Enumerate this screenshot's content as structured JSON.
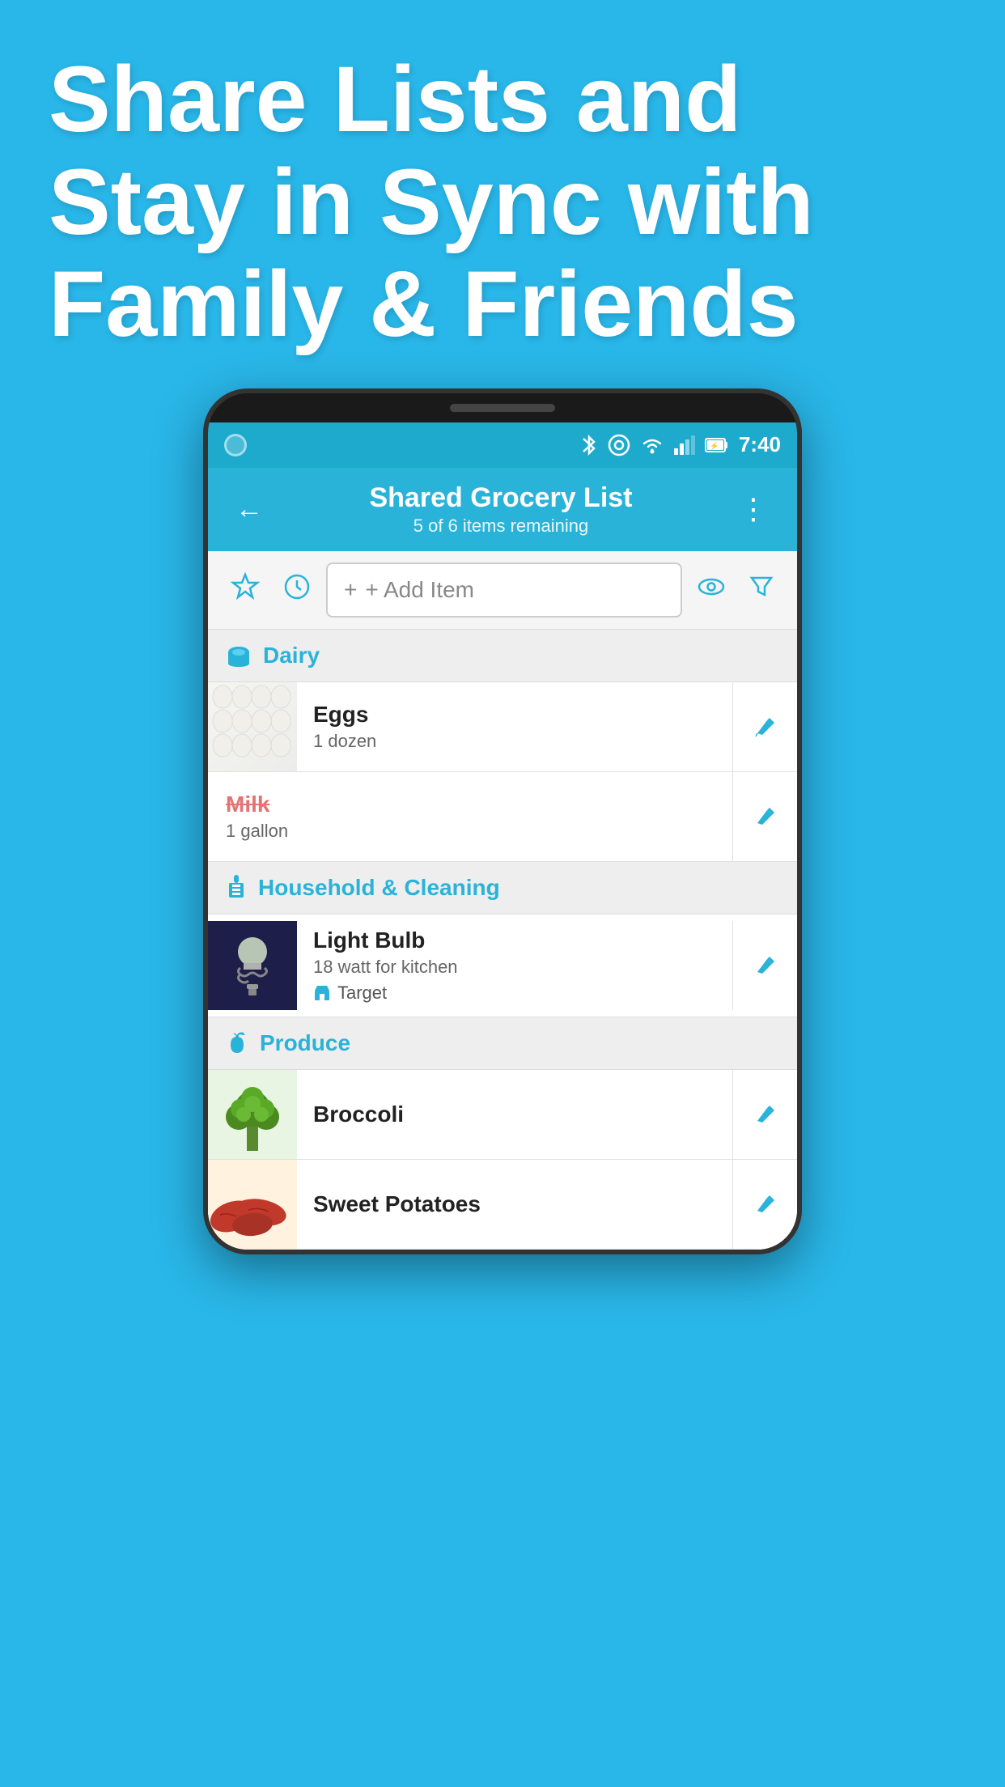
{
  "hero": {
    "title": "Share Lists and Stay in Sync with Family & Friends",
    "background_color": "#29b6e8"
  },
  "status_bar": {
    "time": "7:40",
    "icons": [
      "bluetooth",
      "target-circle",
      "wifi",
      "signal",
      "battery"
    ]
  },
  "app_header": {
    "title": "Shared Grocery List",
    "subtitle": "5 of 6 items remaining",
    "back_label": "←",
    "more_label": "⋮"
  },
  "toolbar": {
    "favorite_icon": "☆",
    "history_icon": "🕐",
    "add_item_label": "+ Add Item",
    "view_icon": "👁",
    "filter_icon": "⬦"
  },
  "categories": [
    {
      "id": "dairy",
      "label": "Dairy",
      "icon": "dairy",
      "items": [
        {
          "id": "eggs",
          "name": "Eggs",
          "detail": "1 dozen",
          "crossed": false,
          "has_image": true,
          "image_type": "eggs",
          "store": null
        },
        {
          "id": "milk",
          "name": "Milk",
          "detail": "1 gallon",
          "crossed": true,
          "has_image": false,
          "image_type": null,
          "store": null
        }
      ]
    },
    {
      "id": "household",
      "label": "Household & Cleaning",
      "icon": "cleaning",
      "items": [
        {
          "id": "lightbulb",
          "name": "Light Bulb",
          "detail": "18 watt for kitchen",
          "crossed": false,
          "has_image": true,
          "image_type": "lightbulb",
          "store": "Target",
          "store_icon": "🏠"
        }
      ]
    },
    {
      "id": "produce",
      "label": "Produce",
      "icon": "apple",
      "items": [
        {
          "id": "broccoli",
          "name": "Broccoli",
          "detail": "",
          "crossed": false,
          "has_image": true,
          "image_type": "broccoli",
          "store": null
        },
        {
          "id": "sweetpotatoes",
          "name": "Sweet Potatoes",
          "detail": "",
          "crossed": false,
          "has_image": true,
          "image_type": "sweetpotato",
          "store": null
        }
      ]
    }
  ]
}
